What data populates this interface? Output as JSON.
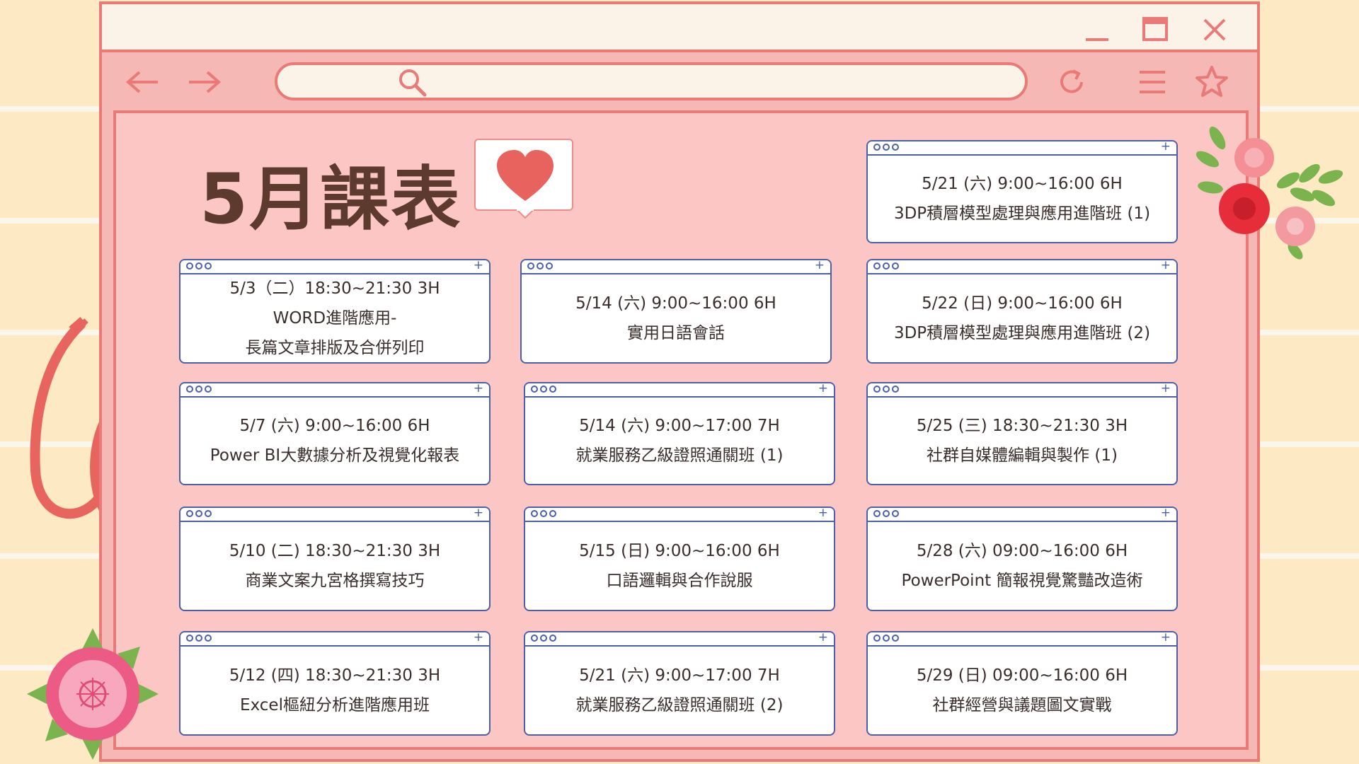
{
  "window": {
    "controls": {
      "minimize_icon": "minimize-icon",
      "maximize_icon": "maximize-icon",
      "close_icon": "close-icon"
    }
  },
  "toolbar": {
    "back_icon": "arrow-left-icon",
    "forward_icon": "arrow-right-icon",
    "search_icon": "search-icon",
    "reload_icon": "reload-icon",
    "menu_icon": "hamburger-menu-icon",
    "bookmark_icon": "star-icon"
  },
  "page": {
    "title": "5月課表",
    "heart_icon": "heart-icon"
  },
  "colors": {
    "frame": "#e97a78",
    "content_bg": "#fcc6c4",
    "card_border": "#4b5faa",
    "title": "#5c3a2e",
    "heart": "#e8625e"
  },
  "courses": [
    {
      "line1": "5/3（二）18:30~21:30 3H",
      "line2": "WORD進階應用-",
      "line3": "長篇文章排版及合併列印"
    },
    {
      "line1": "5/14 (六)  9:00~16:00 6H",
      "line2": "實用日語會話"
    },
    {
      "line1": "5/21 (六)   9:00~16:00 6H",
      "line2": "3DP積層模型處理與應用進階班 (1)"
    },
    {
      "line1": "5/22 (日)  9:00~16:00 6H",
      "line2": "3DP積層模型處理與應用進階班 (2)"
    },
    {
      "line1": "5/7 (六)  9:00~16:00   6H",
      "line2": "Power BI大數據分析及視覺化報表"
    },
    {
      "line1": "5/14 (六)  9:00~17:00 7H",
      "line2": "就業服務乙級證照通關班  (1)"
    },
    {
      "line1": "5/25 (三)  18:30~21:30 3H",
      "line2": "社群自媒體編輯與製作  (1)"
    },
    {
      "line1": "5/10 (二) 18:30~21:30 3H",
      "line2": "商業文案九宮格撰寫技巧"
    },
    {
      "line1": "5/15  (日) 9:00~16:00 6H",
      "line2": "口語邏輯與合作說服"
    },
    {
      "line1": "5/28 (六)  09:00~16:00 6H",
      "line2": "PowerPoint 簡報視覺驚豔改造術"
    },
    {
      "line1": "5/12 (四)  18:30~21:30 3H",
      "line2": "Excel樞紐分析進階應用班"
    },
    {
      "line1": "5/21 (六)  9:00~17:00 7H",
      "line2": "就業服務乙級證照通關班  (2)"
    },
    {
      "line1": "5/29 (日)  09:00~16:00 6H",
      "line2": "社群經營與議題圖文實戰"
    }
  ]
}
